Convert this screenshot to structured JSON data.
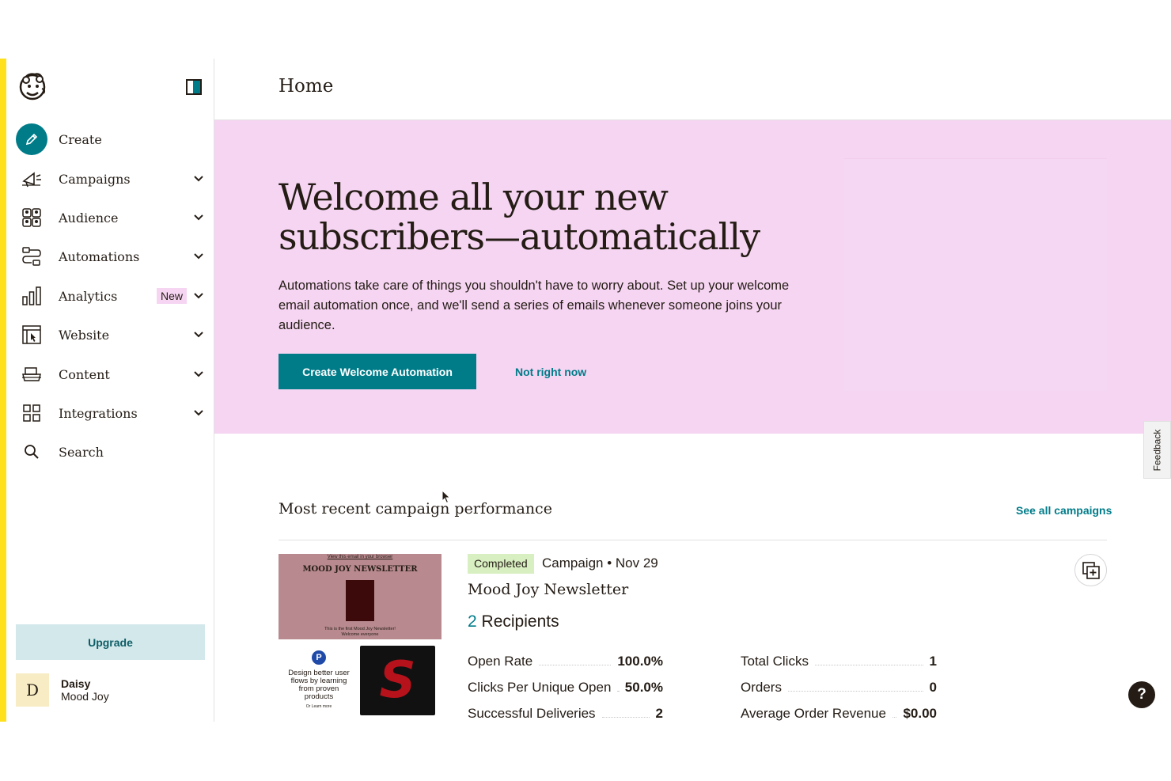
{
  "header": {
    "title": "Home"
  },
  "sidebar": {
    "items": [
      {
        "label": "Create",
        "icon": "pencil-icon"
      },
      {
        "label": "Campaigns",
        "icon": "megaphone-icon"
      },
      {
        "label": "Audience",
        "icon": "people-icon"
      },
      {
        "label": "Automations",
        "icon": "automation-flow-icon"
      },
      {
        "label": "Analytics",
        "icon": "bar-chart-icon",
        "badge": "New"
      },
      {
        "label": "Website",
        "icon": "website-icon"
      },
      {
        "label": "Content",
        "icon": "content-stack-icon"
      },
      {
        "label": "Integrations",
        "icon": "grid-icon"
      },
      {
        "label": "Search",
        "icon": "search-icon"
      }
    ],
    "upgrade_label": "Upgrade",
    "user": {
      "initial": "D",
      "name": "Daisy",
      "org": "Mood Joy"
    }
  },
  "hero": {
    "title": "Welcome all your new subscribers—automatically",
    "description": "Automations take care of things you shouldn't have to worry about. Set up your welcome email automation once, and we'll send a series of emails whenever someone joins your audience.",
    "primary_label": "Create Welcome Automation",
    "secondary_label": "Not right now"
  },
  "feedback_label": "Feedback",
  "recent": {
    "title": "Most recent campaign performance",
    "see_all": "See all campaigns",
    "campaign": {
      "status": "Completed",
      "meta": "Campaign • Nov 29",
      "name": "Mood Joy Newsletter",
      "recipients_count": "2",
      "recipients_label": "Recipients",
      "thumbnail": {
        "top_small": "View this email in your browser",
        "title": "MOOD JOY NEWSLETTER",
        "subtitle1": "This is the first Mood Joy Newsletter!",
        "subtitle2": "Welcome everyone",
        "pin": "P",
        "copy": "Design better user flows by learning from proven products",
        "tiny": "Or Learn more",
        "logo_letter": "S"
      },
      "stats_left": [
        {
          "label": "Open Rate",
          "value": "100.0%"
        },
        {
          "label": "Clicks Per Unique Open",
          "value": "50.0%"
        },
        {
          "label": "Successful Deliveries",
          "value": "2"
        }
      ],
      "stats_right": [
        {
          "label": "Total Clicks",
          "value": "1"
        },
        {
          "label": "Orders",
          "value": "0"
        },
        {
          "label": "Average Order Revenue",
          "value": "$0.00"
        }
      ]
    }
  },
  "help_label": "?",
  "colors": {
    "accent": "#007c89",
    "hero_bg": "#f5d5f2",
    "brand_yellow": "#ffe01b",
    "badge_green": "#d8efc2"
  }
}
